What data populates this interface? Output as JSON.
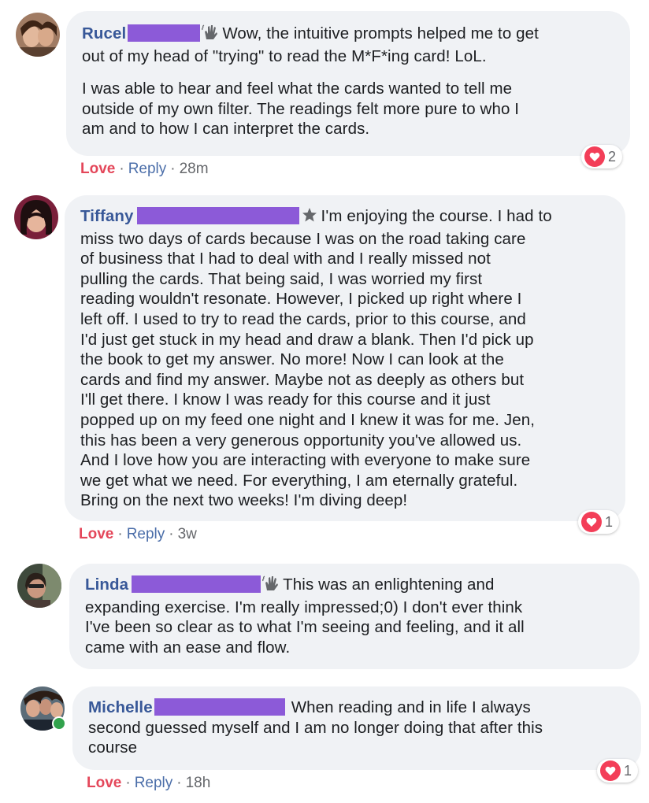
{
  "comments": [
    {
      "name": "Rucel",
      "badge": "waving-hand-icon",
      "lines": [
        "Wow, the intuitive prompts helped me to get",
        "out of my head of \"trying\" to read the M*F*ing card! LoL."
      ],
      "lines2": [
        "I was able to hear and feel what the cards wanted to tell me",
        "outside of my own filter. The readings felt more pure to who I",
        "am and to how I can interpret the cards."
      ],
      "love": "Love",
      "reply": "Reply",
      "time": "28m",
      "reaction_count": "2"
    },
    {
      "name": "Tiffany",
      "badge": "rising-star-icon",
      "lines": [
        "I'm enjoying the course. I had to",
        "miss two days of cards because I was on the road taking care",
        "of business that I had to deal with and I really missed not",
        "pulling the cards. That being said, I was worried my first",
        "reading wouldn't resonate. However, I picked up right where I",
        "left off. I used to try to read the cards, prior to this course, and",
        "I'd just get stuck in my head and draw a blank. Then I'd pick up",
        "the book to get my answer. No more! Now I can look at the",
        "cards and find my answer. Maybe not as deeply as others but",
        "I'll get there. I know I was ready for this course and it just",
        "popped up on my feed one night and I knew it was for me. Jen,",
        "this has been a very generous opportunity you've allowed us.",
        "And I love how you are interacting with everyone to make sure",
        "we get what we need. For everything, I am eternally grateful.",
        "Bring on the next two weeks! I'm diving deep!"
      ],
      "love": "Love",
      "reply": "Reply",
      "time": "3w",
      "reaction_count": "1"
    },
    {
      "name": "Linda",
      "badge": "waving-hand-icon",
      "lines": [
        "This was an enlightening and",
        "expanding exercise. I'm really impressed;0) I don't ever think",
        "I've been so clear as to what I'm seeing and feeling, and it all",
        "came with an ease and flow."
      ]
    },
    {
      "name": "Michelle",
      "lines": [
        "When reading and in life I always",
        "second guessed myself and I am no longer doing that after this",
        "course"
      ],
      "love": "Love",
      "reply": "Reply",
      "time": "18h",
      "reaction_count": "1"
    }
  ],
  "colors": {
    "name": "#385898",
    "love": "#e4475a",
    "redaction": "#8c5ad8",
    "bubble": "#f0f2f5",
    "heart": "#f33e58",
    "online": "#31a24c"
  }
}
